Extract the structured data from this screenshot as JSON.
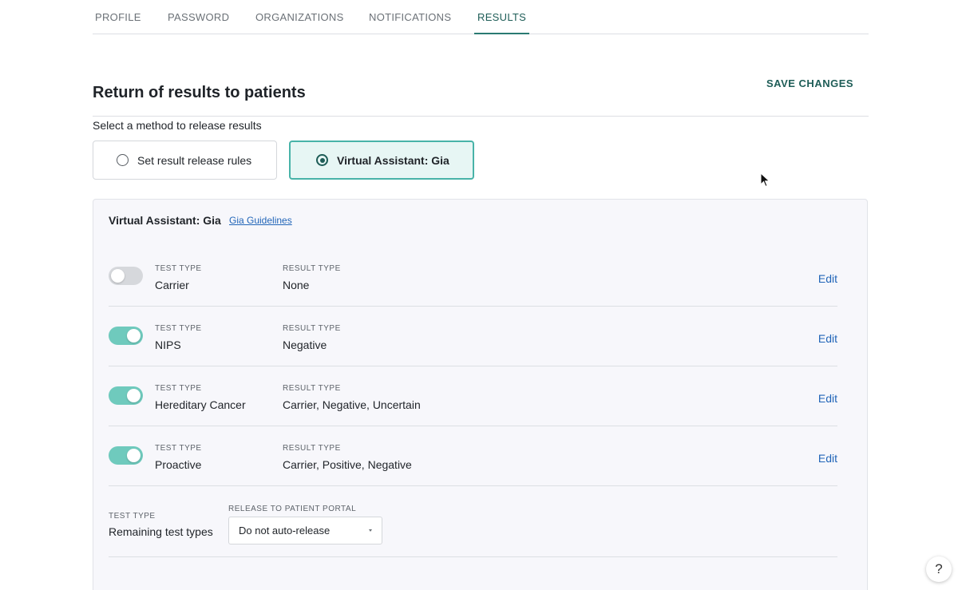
{
  "tabs": [
    {
      "label": "PROFILE"
    },
    {
      "label": "PASSWORD"
    },
    {
      "label": "ORGANIZATIONS"
    },
    {
      "label": "NOTIFICATIONS"
    },
    {
      "label": "RESULTS",
      "active": true
    }
  ],
  "header": {
    "title": "Return of results to patients",
    "save_label": "SAVE CHANGES"
  },
  "release_method": {
    "prompt": "Select a method to release results",
    "options": [
      {
        "label": "Set result release rules",
        "selected": false
      },
      {
        "label": "Virtual Assistant: Gia",
        "selected": true
      }
    ]
  },
  "gia_panel": {
    "title": "Virtual Assistant: Gia",
    "guidelines_link": "Gia Guidelines",
    "test_type_caption": "TEST TYPE",
    "result_type_caption": "RESULT TYPE",
    "edit_label": "Edit",
    "rows": [
      {
        "test_type": "Carrier",
        "result_type": "None",
        "enabled": false
      },
      {
        "test_type": "NIPS",
        "result_type": "Negative",
        "enabled": true
      },
      {
        "test_type": "Hereditary Cancer",
        "result_type": "Carrier, Negative, Uncertain",
        "enabled": true
      },
      {
        "test_type": "Proactive",
        "result_type": "Carrier, Positive, Negative",
        "enabled": true
      }
    ],
    "remaining": {
      "test_type_caption": "TEST TYPE",
      "test_type": "Remaining test types",
      "release_caption": "RELEASE TO PATIENT PORTAL",
      "release_value": "Do not auto-release"
    }
  },
  "help_label": "?",
  "colors": {
    "accent": "#1e5d57",
    "selected_bg": "#e7f6f4",
    "toggle_on": "#6fcabd",
    "link": "#2165b8"
  }
}
